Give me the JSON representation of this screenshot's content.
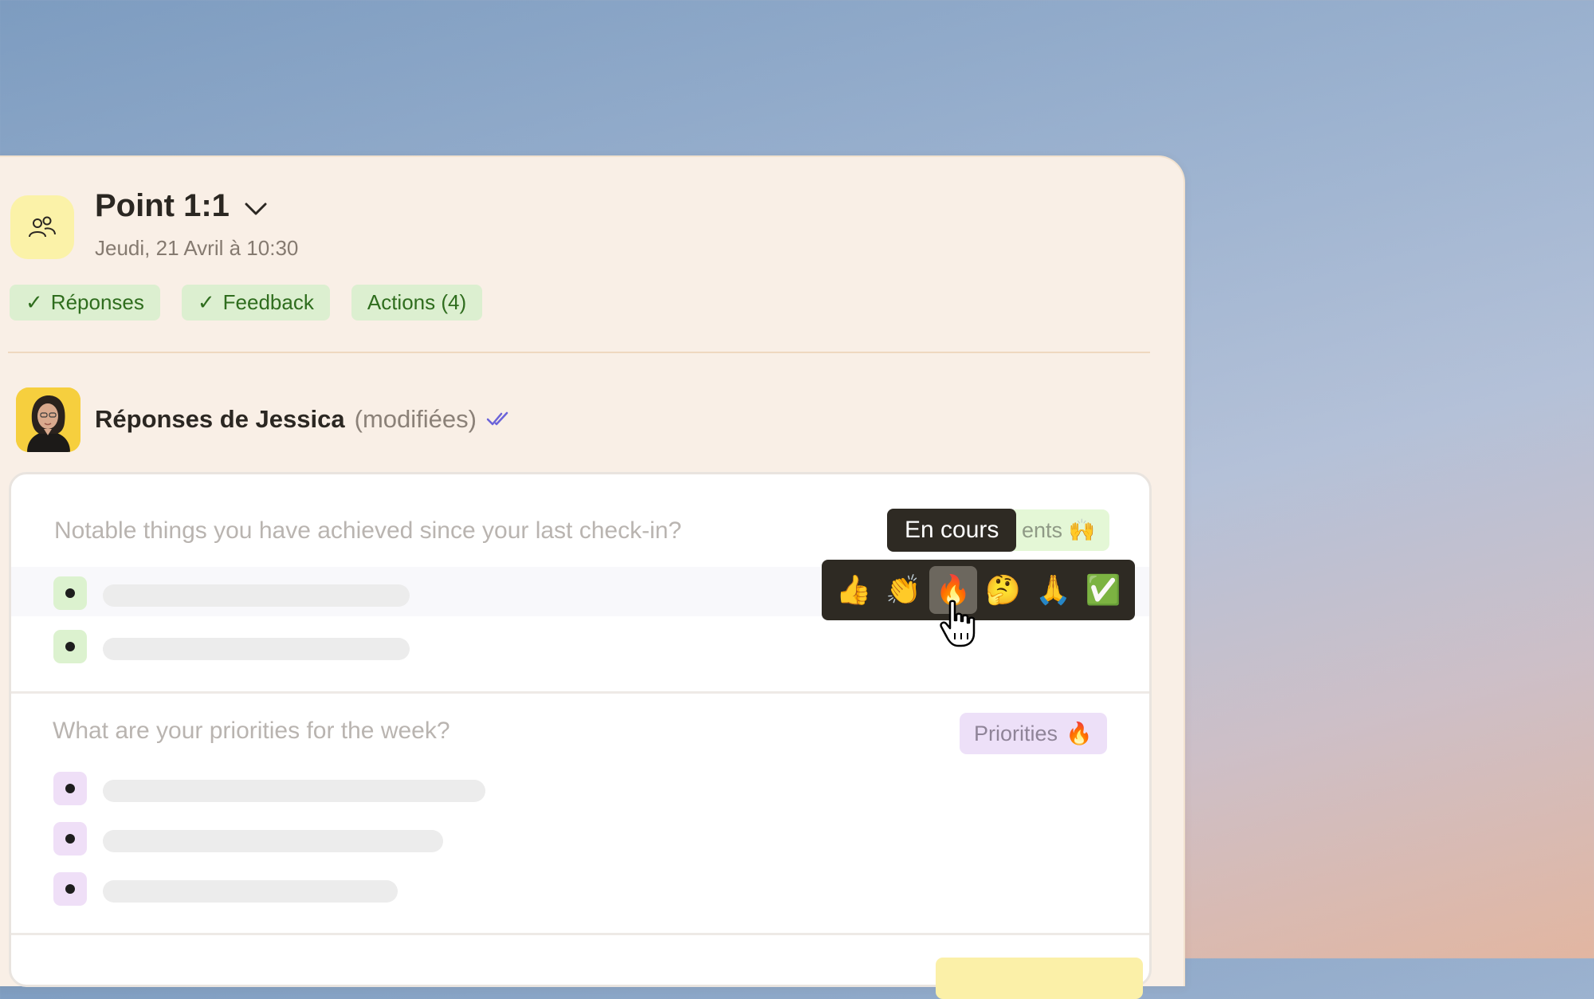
{
  "header": {
    "title": "Point 1:1",
    "subtitle": "Jeudi, 21 Avril à 10:30",
    "icon": "people-icon",
    "icon_bg": "#fbf2a8"
  },
  "tabs": [
    {
      "label": "Réponses",
      "checked": true
    },
    {
      "label": "Feedback",
      "checked": true
    },
    {
      "label": "Actions (4)",
      "checked": false
    }
  ],
  "responses": {
    "name": "Réponses de Jessica",
    "status": "(modifiées)",
    "read_icon": "double-check-icon"
  },
  "questions": [
    {
      "text": "Notable things you have achieved since your last check-in?",
      "badge_visible_text": "ents 🙌",
      "bullet_color": "#dcf2cf",
      "items": 2
    },
    {
      "text": "What are your priorities for the week?",
      "badge_label": "Priorities",
      "badge_emoji": "🔥",
      "bullet_color": "#efdff7",
      "items": 3
    }
  ],
  "tooltip": "En cours",
  "reactions": [
    {
      "emoji": "👍",
      "name": "thumbs-up"
    },
    {
      "emoji": "👏",
      "name": "clap"
    },
    {
      "emoji": "🔥",
      "name": "fire",
      "active": true
    },
    {
      "emoji": "🤔",
      "name": "thinking"
    },
    {
      "emoji": "🙏",
      "name": "pray"
    },
    {
      "emoji": "✅",
      "name": "check"
    }
  ],
  "colors": {
    "panel_bg": "#f9efe6",
    "tag_bg": "#dcefd0",
    "tag_text": "#2f6d1e",
    "accent_check": "#6b63d9"
  }
}
